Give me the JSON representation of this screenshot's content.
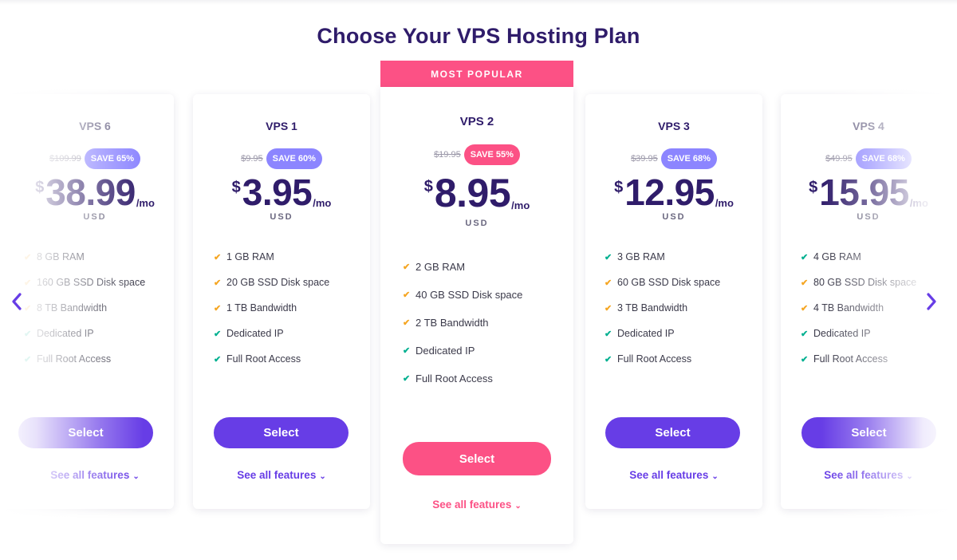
{
  "page": {
    "title": "Choose Your VPS Hosting Plan",
    "badge": "MOST POPULAR"
  },
  "nav": {
    "prev_icon": "chevron-left-icon",
    "next_icon": "chevron-right-icon"
  },
  "colors": {
    "primary": "#673de6",
    "accent": "#fc5185",
    "save_badge": "#8c85ff",
    "heading": "#2f1c6a",
    "check_orange": "#f5a623",
    "check_green": "#00b090"
  },
  "plans": [
    {
      "name": "VPS 6",
      "old_price": "$109.99",
      "save": "SAVE 65%",
      "currency_symbol": "$",
      "price": "38.99",
      "period": "/mo",
      "currency": "USD",
      "features": [
        {
          "text": "8 GB RAM",
          "check": "orange"
        },
        {
          "text": "160 GB SSD Disk space",
          "check": "orange"
        },
        {
          "text": "8 TB Bandwidth",
          "check": "orange"
        },
        {
          "text": "Dedicated IP",
          "check": "green"
        },
        {
          "text": "Full Root Access",
          "check": "green"
        }
      ],
      "select": "Select",
      "see_all": "See all features"
    },
    {
      "name": "VPS 1",
      "old_price": "$9.95",
      "save": "SAVE 60%",
      "currency_symbol": "$",
      "price": "3.95",
      "period": "/mo",
      "currency": "USD",
      "features": [
        {
          "text": "1 GB RAM",
          "check": "orange"
        },
        {
          "text": "20 GB SSD Disk space",
          "check": "orange"
        },
        {
          "text": "1 TB Bandwidth",
          "check": "orange"
        },
        {
          "text": "Dedicated IP",
          "check": "green"
        },
        {
          "text": "Full Root Access",
          "check": "green"
        }
      ],
      "select": "Select",
      "see_all": "See all features"
    },
    {
      "name": "VPS 2",
      "old_price": "$19.95",
      "save": "SAVE 55%",
      "currency_symbol": "$",
      "price": "8.95",
      "period": "/mo",
      "currency": "USD",
      "features": [
        {
          "text": "2 GB RAM",
          "check": "orange"
        },
        {
          "text": "40 GB SSD Disk space",
          "check": "orange"
        },
        {
          "text": "2 TB Bandwidth",
          "check": "orange"
        },
        {
          "text": "Dedicated IP",
          "check": "green"
        },
        {
          "text": "Full Root Access",
          "check": "green"
        }
      ],
      "select": "Select",
      "see_all": "See all features"
    },
    {
      "name": "VPS 3",
      "old_price": "$39.95",
      "save": "SAVE 68%",
      "currency_symbol": "$",
      "price": "12.95",
      "period": "/mo",
      "currency": "USD",
      "features": [
        {
          "text": "3 GB RAM",
          "check": "green"
        },
        {
          "text": "60 GB SSD Disk space",
          "check": "orange"
        },
        {
          "text": "3 TB Bandwidth",
          "check": "orange"
        },
        {
          "text": "Dedicated IP",
          "check": "green"
        },
        {
          "text": "Full Root Access",
          "check": "green"
        }
      ],
      "select": "Select",
      "see_all": "See all features"
    },
    {
      "name": "VPS 4",
      "old_price": "$49.95",
      "save": "SAVE 68%",
      "currency_symbol": "$",
      "price": "15.95",
      "period": "/mo",
      "currency": "USD",
      "features": [
        {
          "text": "4 GB RAM",
          "check": "green"
        },
        {
          "text": "80 GB SSD Disk space",
          "check": "orange"
        },
        {
          "text": "4 TB Bandwidth",
          "check": "orange"
        },
        {
          "text": "Dedicated IP",
          "check": "green"
        },
        {
          "text": "Full Root Access",
          "check": "green"
        }
      ],
      "select": "Select",
      "see_all": "See all features"
    }
  ]
}
